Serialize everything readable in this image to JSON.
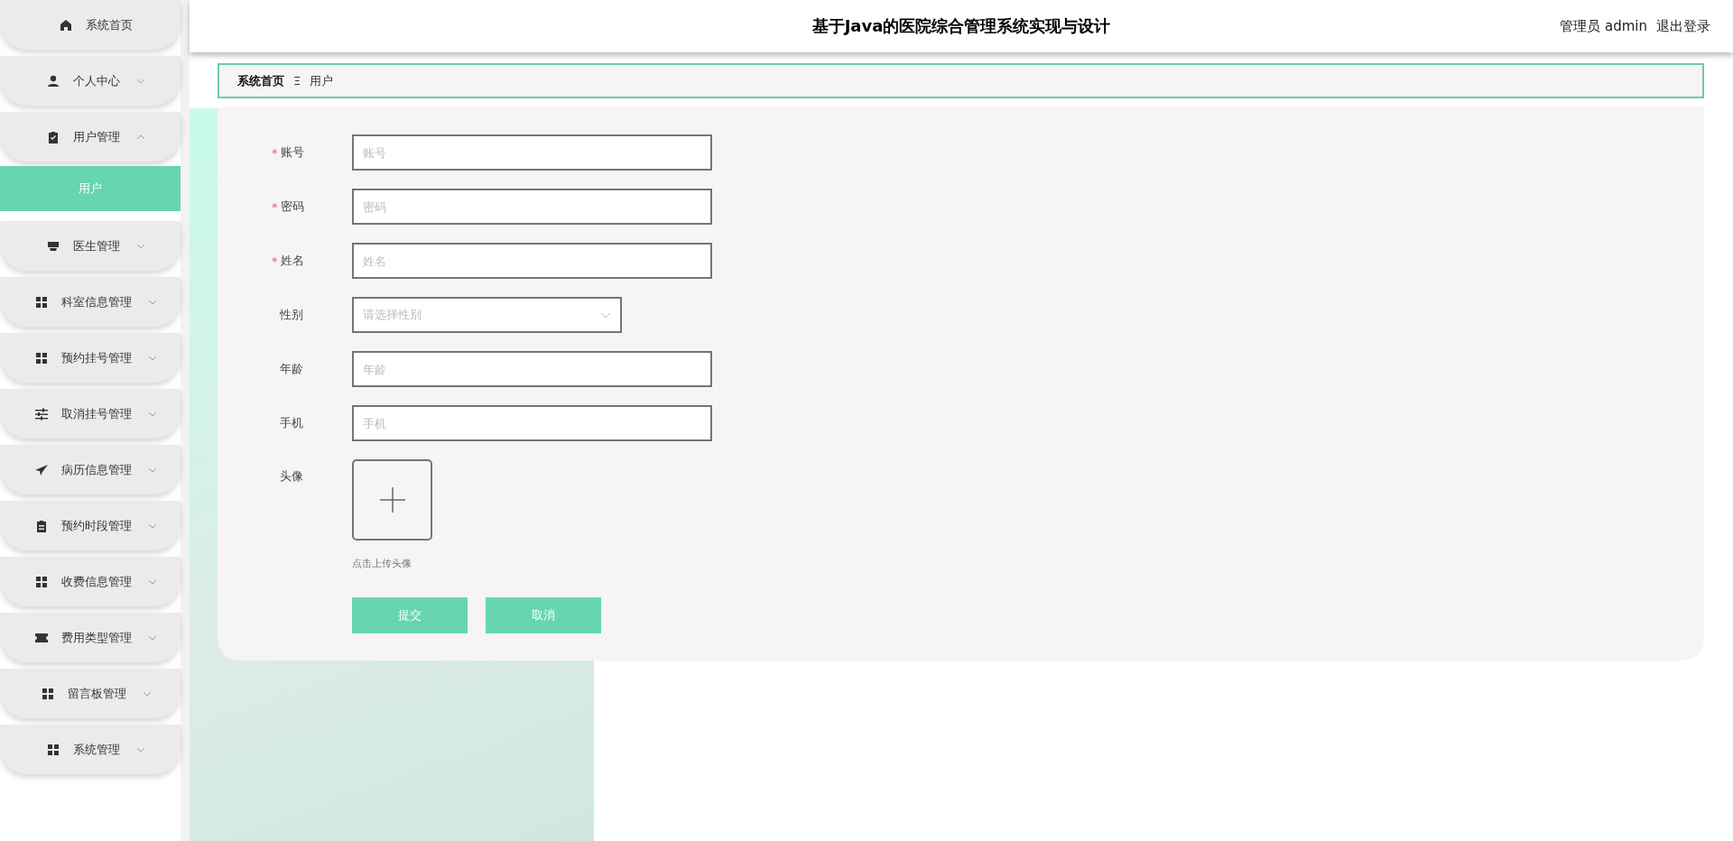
{
  "sidebar": {
    "items": [
      {
        "label": "系统首页"
      },
      {
        "label": "个人中心",
        "expanded": false
      },
      {
        "label": "用户管理",
        "expanded": true,
        "children": [
          {
            "label": "用户",
            "selected": true
          }
        ]
      },
      {
        "label": "医生管理",
        "expanded": false
      },
      {
        "label": "科室信息管理",
        "expanded": false
      },
      {
        "label": "预约挂号管理",
        "expanded": false
      },
      {
        "label": "取消挂号管理",
        "expanded": false
      },
      {
        "label": "病历信息管理",
        "expanded": false
      },
      {
        "label": "预约时段管理",
        "expanded": false
      },
      {
        "label": "收费信息管理",
        "expanded": false
      },
      {
        "label": "费用类型管理",
        "expanded": false
      },
      {
        "label": "留言板管理",
        "expanded": false
      },
      {
        "label": "系统管理",
        "expanded": false
      }
    ]
  },
  "header": {
    "title": "基于Java的医院综合管理系统实现与设计",
    "user": "管理员 admin",
    "logout": "退出登录"
  },
  "breadcrumb": [
    {
      "label": "系统首页"
    },
    {
      "label": "用户"
    }
  ],
  "breadcrumb_separator": "Ξ",
  "form": {
    "fields": [
      {
        "kind": "input",
        "label": "账号",
        "required_mark": "*",
        "placeholder": "账号"
      },
      {
        "kind": "input",
        "label": "密码",
        "required_mark": "*",
        "placeholder": "密码"
      },
      {
        "kind": "input",
        "label": "姓名",
        "required_mark": "*",
        "placeholder": "姓名"
      },
      {
        "kind": "select",
        "label": "性别",
        "placeholder": "请选择性别"
      },
      {
        "kind": "input",
        "label": "年龄",
        "placeholder": "年龄"
      },
      {
        "kind": "input",
        "label": "手机",
        "placeholder": "手机"
      },
      {
        "kind": "upload",
        "label": "头像",
        "hint": "点击上传头像"
      }
    ],
    "buttons": [
      "提交",
      "取消"
    ]
  }
}
